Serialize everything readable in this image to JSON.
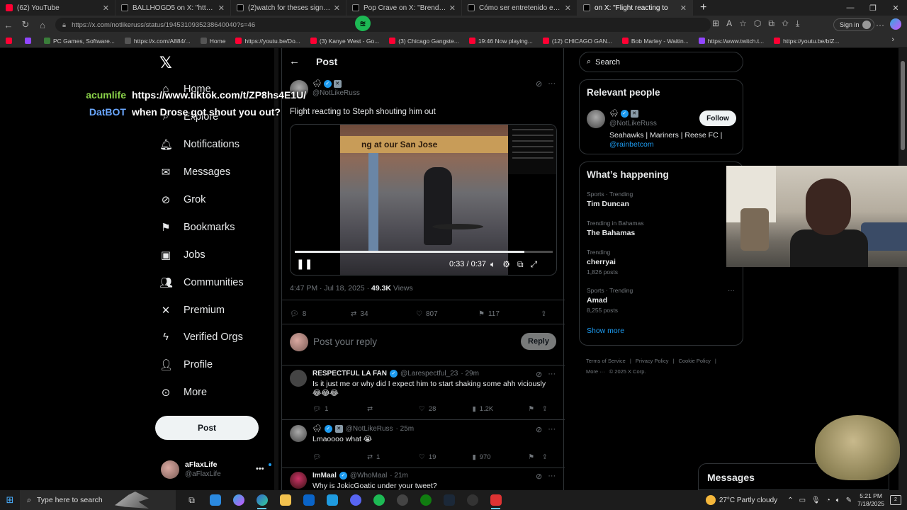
{
  "browser": {
    "tabs": [
      {
        "title": "(62) YouTube",
        "color": "#ff0033",
        "active": false
      },
      {
        "title": "BALLHOGD5 on X: \"https://t.co/u",
        "color": "#000000",
        "active": false
      },
      {
        "title": "(2)watch for theses signs... #greed",
        "color": "#000000",
        "active": false
      },
      {
        "title": "Pop Crave on X: \"Brenda Song lo",
        "color": "#000000",
        "active": false
      },
      {
        "title": "Cómo ser entretenido en tus tran",
        "color": "#000000",
        "active": false
      },
      {
        "title": "on X: \"Flight reacting to",
        "color": "#000000",
        "active": true
      }
    ],
    "new_tab": "+",
    "url": "https://x.com/notlikeruss/status/1945310935238640040?s=46",
    "sign_in": "Sign in",
    "bookmarks": [
      {
        "label": "",
        "color": "#ff0033"
      },
      {
        "label": "",
        "color": "#9146ff"
      },
      {
        "label": "PC Games, Software...",
        "color": "#3a7d3a"
      },
      {
        "label": "https://x.com/A884/...",
        "color": "#555555"
      },
      {
        "label": "Home",
        "color": "#555555"
      },
      {
        "label": "https://youtu.be/Do...",
        "color": "#ff0033"
      },
      {
        "label": "(3) Kanye West - Go...",
        "color": "#ff0033"
      },
      {
        "label": "(3) Chicago Gangste...",
        "color": "#ff0033"
      },
      {
        "label": "19:46 Now playing...",
        "color": "#ff0033"
      },
      {
        "label": "(12) CHICAGO GAN...",
        "color": "#ff0033"
      },
      {
        "label": "Bob Marley - Waitin...",
        "color": "#ff0033"
      },
      {
        "label": "https://www.twitch.t...",
        "color": "#9146ff"
      },
      {
        "label": "https://youtu.be/blZ...",
        "color": "#ff0033"
      }
    ]
  },
  "nav": {
    "items": [
      {
        "label": "Home",
        "icon": "home-icon",
        "glyph": "⌂"
      },
      {
        "label": "Explore",
        "icon": "search-icon",
        "glyph": "⌕"
      },
      {
        "label": "Notifications",
        "icon": "bell-icon",
        "glyph": "🔔︎"
      },
      {
        "label": "Messages",
        "icon": "mail-icon",
        "glyph": "✉"
      },
      {
        "label": "Grok",
        "icon": "grok-icon",
        "glyph": "⊘"
      },
      {
        "label": "Bookmarks",
        "icon": "bookmark-icon",
        "glyph": "⚑"
      },
      {
        "label": "Jobs",
        "icon": "briefcase-icon",
        "glyph": "▣"
      },
      {
        "label": "Communities",
        "icon": "people-icon",
        "glyph": "👥︎"
      },
      {
        "label": "Premium",
        "icon": "x-logo-icon",
        "glyph": "✕"
      },
      {
        "label": "Verified Orgs",
        "icon": "lightning-icon",
        "glyph": "ϟ"
      },
      {
        "label": "Profile",
        "icon": "person-icon",
        "glyph": "👤︎"
      },
      {
        "label": "More",
        "icon": "more-circle-icon",
        "glyph": "⊙"
      }
    ],
    "post_button": "Post",
    "account": {
      "name": "aFlaxLife",
      "handle": "@aFlaxLife"
    }
  },
  "overlay_chat": [
    {
      "user": "acumlife",
      "message": "https://www.tiktok.com/t/ZP8hs4E1U/"
    },
    {
      "user": "DatBOT",
      "message": "when Drose got shout you out?"
    }
  ],
  "post": {
    "header": "Post",
    "author_handle": "@NotLikeRuss",
    "text": "Flight reacting to Steph shouting him out",
    "video": {
      "store_sign": "ng at our San Jose ",
      "time": "0:33 / 0:37",
      "progress": 0.89
    },
    "timestamp": "4:47 PM · Jul 18, 2025 · ",
    "views_count": "49.3K",
    "views_label": " Views",
    "stats": {
      "replies": "8",
      "reposts": "34",
      "likes": "807",
      "bookmarks": "117"
    },
    "reply_placeholder": "Post your reply",
    "reply_button": "Reply"
  },
  "replies": [
    {
      "name": "RESPECTFUL LA FAN",
      "handle": "@Larespectful_23",
      "time": "· 29m",
      "text": "Is it just me or why did I expect him to start shaking some ahh viciously 😂😂😂",
      "replies": "1",
      "reposts": "",
      "likes": "28",
      "views": "1.2K"
    },
    {
      "name": "",
      "handle": "@NotLikeRuss",
      "time": "· 25m",
      "text": "Lmaoooo what 😭",
      "replies": "",
      "reposts": "1",
      "likes": "19",
      "views": "970"
    },
    {
      "name": "ImMaal",
      "handle": "@WhoMaal",
      "time": "· 21m",
      "text": "Why is JokicGoatic under your tweet?",
      "replies": "",
      "reposts": "",
      "likes": "",
      "views": ""
    }
  ],
  "sidebar": {
    "search_placeholder": "Search",
    "relevant_title": "Relevant people",
    "relevant_handle": "@NotLikeRuss",
    "relevant_bio": "Seahawks | Mariners | Reese FC |",
    "relevant_link": "@rainbetcom",
    "follow": "Follow",
    "happening_title": "What’s happening",
    "trends": [
      {
        "context": "Sports · Trending",
        "title": "Tim Duncan",
        "count": ""
      },
      {
        "context": "Trending in Bahamas",
        "title": "The Bahamas",
        "count": ""
      },
      {
        "context": "Trending",
        "title": "cherryai",
        "count": "1,826 posts"
      },
      {
        "context": "Sports · Trending",
        "title": "Amad",
        "count": "8,255 posts"
      }
    ],
    "show_more": "Show more",
    "footer": [
      "Terms of Service",
      "|",
      "Privacy Policy",
      "|",
      "Cookie Policy",
      "|",
      "More ···",
      "© 2025 X Corp."
    ]
  },
  "messages_drawer": "Messages",
  "taskbar": {
    "search_placeholder": "Type here to search",
    "weather": "27°C  Partly cloudy",
    "time": "5:21 PM",
    "date": "7/18/2025",
    "notifications": "2"
  }
}
